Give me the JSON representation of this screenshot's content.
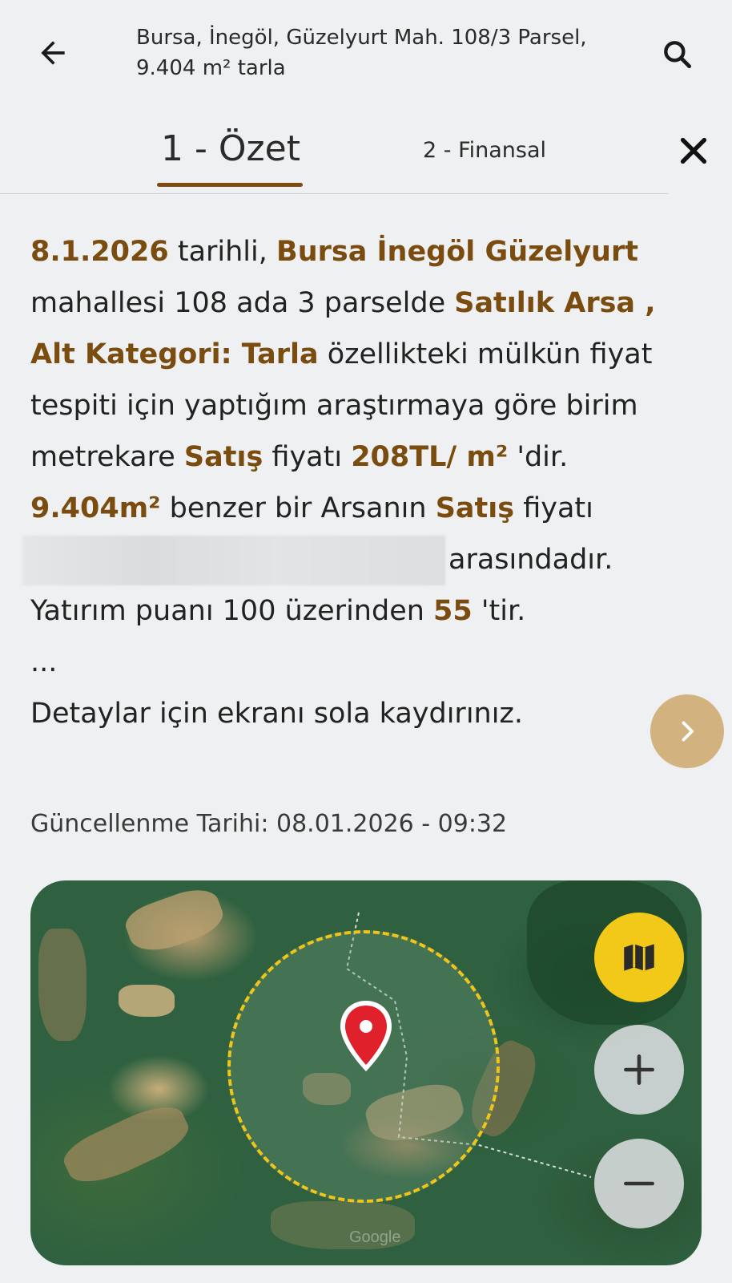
{
  "header": {
    "title_line1": "Bursa, İnegöl, Güzelyurt Mah. 108/3 Parsel,",
    "title_line2": "9.404 m² tarla",
    "back_icon": "arrow-left-icon",
    "search_icon": "search-icon"
  },
  "tabs": [
    {
      "label": "1 - Özet",
      "active": true
    },
    {
      "label": "2 - Finansal",
      "active": false
    }
  ],
  "close_icon": "close-icon",
  "summary": {
    "date": "8.1.2026",
    "t1": " tarihli, ",
    "location": "Bursa İnegöl Güzelyurt",
    "t2": " mahallesi 108 ada 3  parselde ",
    "category": "Satılık Arsa , Alt Kategori: Tarla",
    "t3": " özellikteki mülkün fiyat tespiti için  yaptığım araştırmaya göre birim metrekare ",
    "sale1": "Satış",
    "t4": " fiyatı ",
    "unit_price": "208TL/ m²",
    "t5": " 'dir.",
    "area": "9.404m²",
    "t6": " benzer bir Arsanın  ",
    "sale2": "Satış",
    "t7": " fiyatı",
    "t8": "arasındadır.",
    "t9": "Yatırım puanı 100 üzerinden ",
    "score": "55",
    "t10": " 'tir.",
    "ellipsis": "...",
    "t11": "Detaylar için ekranı sola kaydırınız."
  },
  "next_icon": "chevron-right-icon",
  "updated": "Güncellenme Tarihi: 08.01.2026 - 09:32",
  "map": {
    "marker_icon": "location-pin-icon",
    "layers_icon": "map-icon",
    "zoom_in_icon": "plus-icon",
    "zoom_out_icon": "minus-icon",
    "attribution": "Google"
  },
  "colors": {
    "accent": "#7a4c0f",
    "next_button": "#d2b27e",
    "map_layer_button": "#f2c918",
    "circle_border": "#f0c419",
    "marker": "#e0202a"
  }
}
